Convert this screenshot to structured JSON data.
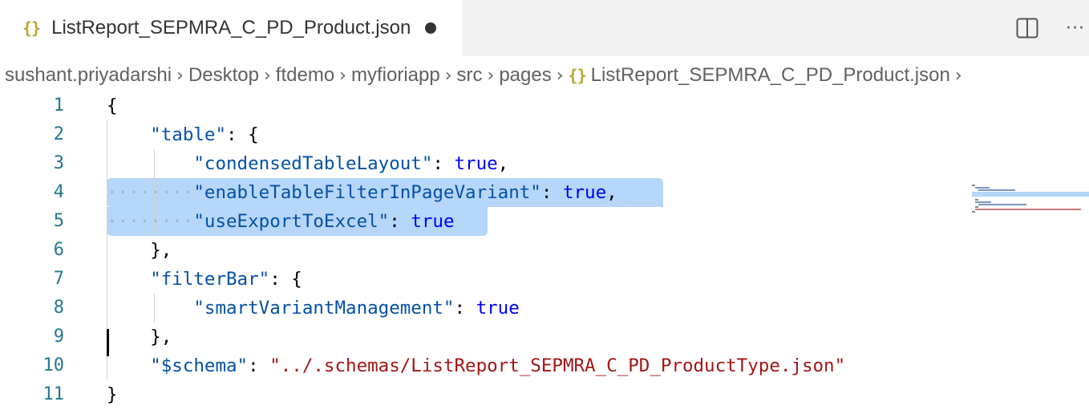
{
  "tab": {
    "icon": "{}",
    "title": "ListReport_SEPMRA_C_PD_Product.json",
    "dirty_indicator": "unsaved-dot"
  },
  "toolbar": {
    "split_editor_icon": "split-editor-icon",
    "more_actions_label": "···"
  },
  "breadcrumb": {
    "items": [
      "sushant.priyadarshi",
      "Desktop",
      "ftdemo",
      "myfioriapp",
      "src",
      "pages"
    ],
    "file_icon": "{}",
    "file": "ListReport_SEPMRA_C_PD_Product.json",
    "separator": "›"
  },
  "editor": {
    "line_numbers": [
      "1",
      "2",
      "3",
      "4",
      "5",
      "6",
      "7",
      "8",
      "9",
      "10",
      "11"
    ],
    "lines": [
      [
        {
          "t": "p",
          "v": "{"
        }
      ],
      [
        {
          "t": "k",
          "v": "\"table\""
        },
        {
          "t": "p",
          "v": ": {"
        }
      ],
      [
        {
          "t": "k",
          "v": "\"condensedTableLayout\""
        },
        {
          "t": "p",
          "v": ": "
        },
        {
          "t": "w",
          "v": "true"
        },
        {
          "t": "p",
          "v": ","
        }
      ],
      [
        {
          "t": "k",
          "v": "\"enableTableFilterInPageVariant\""
        },
        {
          "t": "p",
          "v": ": "
        },
        {
          "t": "w",
          "v": "true"
        },
        {
          "t": "p",
          "v": ","
        }
      ],
      [
        {
          "t": "k",
          "v": "\"useExportToExcel\""
        },
        {
          "t": "p",
          "v": ": "
        },
        {
          "t": "w",
          "v": "true"
        }
      ],
      [
        {
          "t": "p",
          "v": "},"
        }
      ],
      [
        {
          "t": "k",
          "v": "\"filterBar\""
        },
        {
          "t": "p",
          "v": ": {"
        }
      ],
      [
        {
          "t": "k",
          "v": "\"smartVariantManagement\""
        },
        {
          "t": "p",
          "v": ": "
        },
        {
          "t": "w",
          "v": "true"
        }
      ],
      [
        {
          "t": "p",
          "v": "},"
        }
      ],
      [
        {
          "t": "k",
          "v": "\"$schema\""
        },
        {
          "t": "p",
          "v": ": "
        },
        {
          "t": "s",
          "v": "\"../.schemas/ListReport_SEPMRA_C_PD_ProductType.json\""
        }
      ],
      [
        {
          "t": "p",
          "v": "}"
        }
      ]
    ],
    "whitespace_dots": "········",
    "colors": {
      "key": "#0451a5",
      "keyword": "#0000ff",
      "string": "#a31515",
      "line_number": "#237893",
      "selection": "#b6d6fa"
    }
  }
}
